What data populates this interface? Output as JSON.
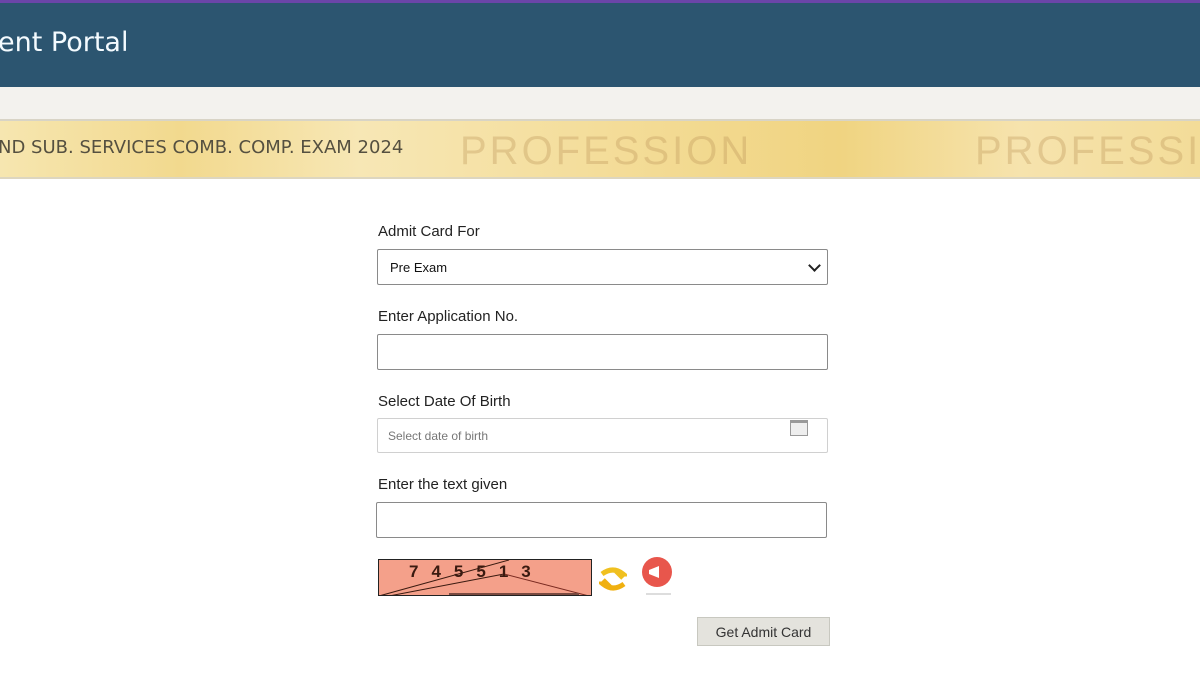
{
  "header": {
    "title": "ent Portal"
  },
  "banner": {
    "exam_title": "ND SUB. SERVICES COMB. COMP. EXAM 2024",
    "watermark": "PROFESSION"
  },
  "form": {
    "admit_card_for": {
      "label": "Admit Card For",
      "value": "Pre Exam"
    },
    "application_no": {
      "label": "Enter Application No.",
      "value": ""
    },
    "dob": {
      "label": "Select Date Of Birth",
      "placeholder": "Select date of birth"
    },
    "captcha_input": {
      "label": "Enter the text given",
      "value": ""
    },
    "captcha_text": "745513",
    "submit_label": "Get Admit Card"
  },
  "colors": {
    "header": "#2c5570",
    "accent_top": "#6b45a8",
    "banner": "#f2d98e"
  }
}
